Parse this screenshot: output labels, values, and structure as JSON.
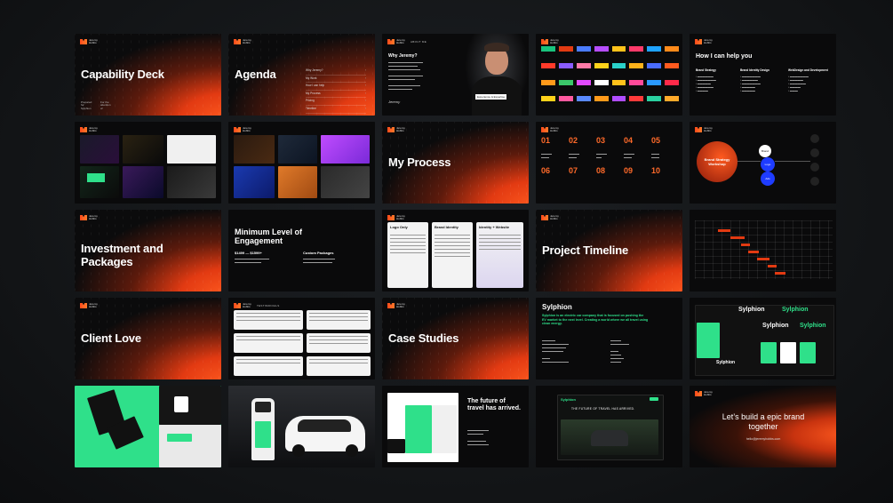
{
  "brand": {
    "logo_text": "Jeremy Hobbs",
    "accent": "#ff5a1f",
    "green": "#2fe08a"
  },
  "slides": {
    "s1": {
      "title": "Capability Deck",
      "foot": [
        "Prepared for: Sylphion",
        "For the attention of"
      ]
    },
    "s2": {
      "title": "Agenda",
      "items": [
        "Why Jeremy?",
        "My Work",
        "How I can help",
        "My Process",
        "Pricing",
        "Timeline",
        "Client Love",
        "Case Studies"
      ]
    },
    "s3": {
      "header": "ABOUT ME",
      "title": "Why Jeremy?",
      "badge": "Experience & Expertise",
      "sign": "Jeremy"
    },
    "s5": {
      "title": "How I can help you",
      "cols": [
        "Brand Strategy",
        "Brand Identity Design",
        "WebDesign and Development"
      ]
    },
    "s8": {
      "title": "My Process"
    },
    "s9": {
      "nums": [
        "01",
        "02",
        "03",
        "04",
        "05",
        "06",
        "07",
        "08",
        "09",
        "10"
      ]
    },
    "s10": {
      "center": "Brand Strategy Workshop",
      "nodes": [
        "Brand",
        "Logo",
        "Ads"
      ]
    },
    "s11": {
      "title": "Investment and Packages"
    },
    "s12": {
      "title": "Minimum Level of Engagement",
      "price": "$1499 — $1599+",
      "right": "Custom Packages"
    },
    "s13": {
      "cards": [
        "Logo Only",
        "Brand Identity",
        "Identity + Website"
      ]
    },
    "s14": {
      "title": "Project Timeline"
    },
    "s16": {
      "title": "Client Love"
    },
    "s17": {
      "header": "TESTIMONIALS"
    },
    "s18": {
      "title": "Case Studies"
    },
    "s19": {
      "title": "Sylphion",
      "tagline": "Sylphion is an electric car company that is focused on pushing the EV market to the next level. Creating a world where we all travel using clean energy."
    },
    "s20": {
      "wordmark": "Sylphion"
    },
    "s23": {
      "headline": "The future of travel has arrived."
    },
    "s24": {
      "wordmark": "Sylphion",
      "headline": "THE FUTURE OF TRAVEL HAS ARRIVED."
    },
    "s25": {
      "title": "Let’s build a epic brand together",
      "sub": "hello@jeremyhobbs.com"
    }
  }
}
